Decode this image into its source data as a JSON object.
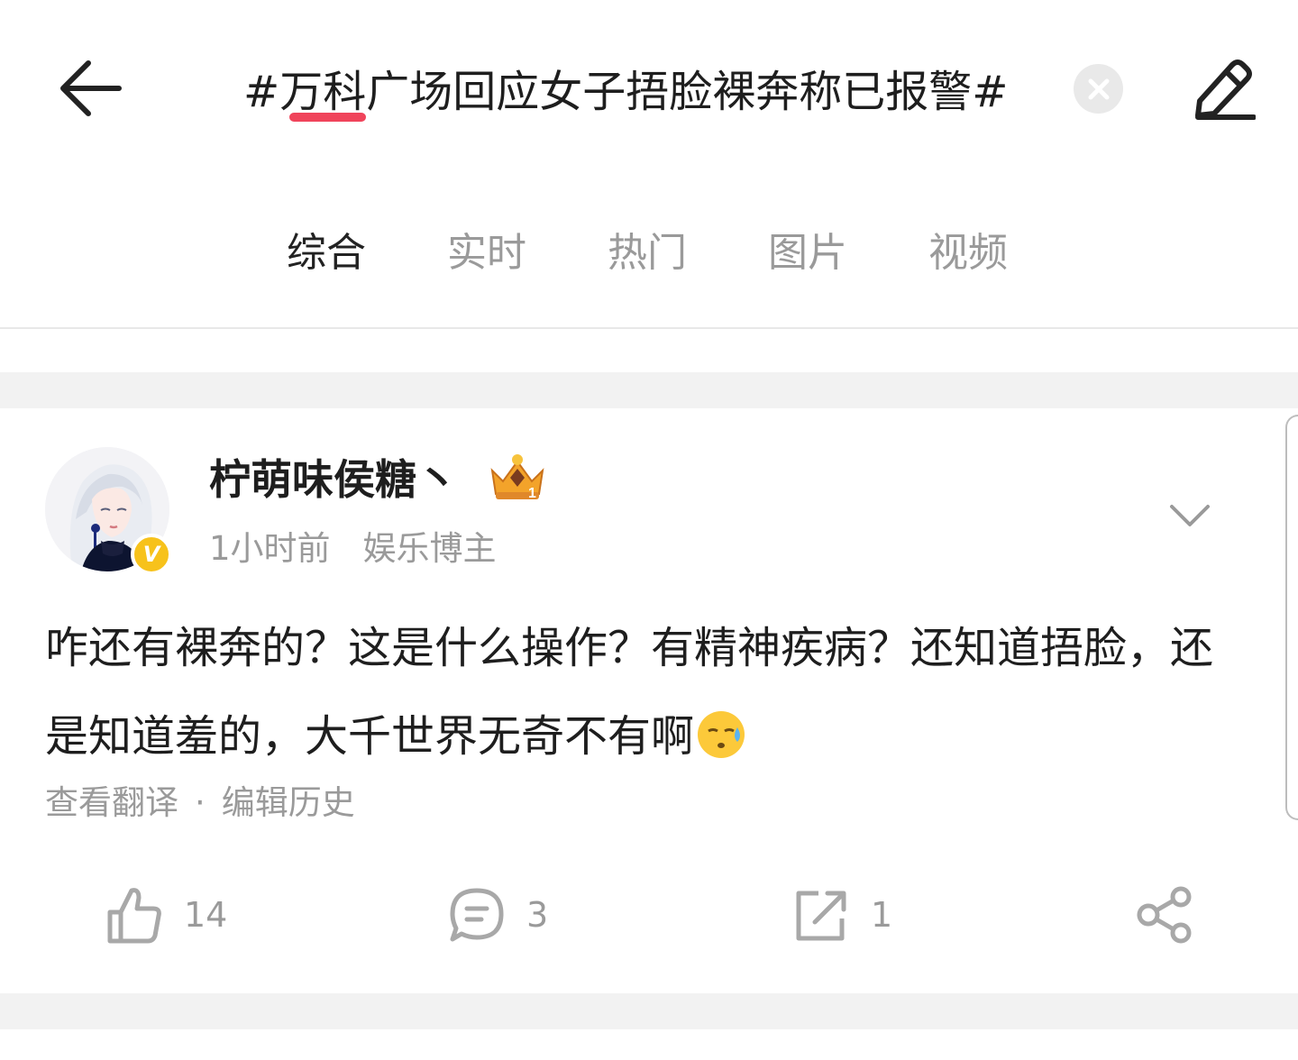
{
  "header": {
    "search_query": "#万科广场回应女子捂脸裸奔称已报警#",
    "icons": {
      "back": "arrow-left-icon",
      "clear": "close-icon",
      "edit": "pencil-icon"
    }
  },
  "tabs": [
    {
      "label": "综合",
      "active": true
    },
    {
      "label": "实时",
      "active": false
    },
    {
      "label": "热门",
      "active": false
    },
    {
      "label": "图片",
      "active": false
    },
    {
      "label": "视频",
      "active": false
    }
  ],
  "accent_color": "#f0445b",
  "post": {
    "author": {
      "name": "柠萌味侯糖丶",
      "verified_badge": "V",
      "crown_badge_number": "1"
    },
    "time": "1小时前",
    "role": "娱乐博主",
    "text": "咋还有裸奔的？这是什么操作？有精神疾病？还知道捂脸，还是知道羞的，大千世界无奇不有啊",
    "trailing_emoji": "sweat-face-emoji",
    "links": {
      "translate": "查看翻译",
      "separator": "·",
      "edit_history": "编辑历史"
    },
    "actions": {
      "like_count": "14",
      "comment_count": "3",
      "repost_count": "1"
    }
  }
}
